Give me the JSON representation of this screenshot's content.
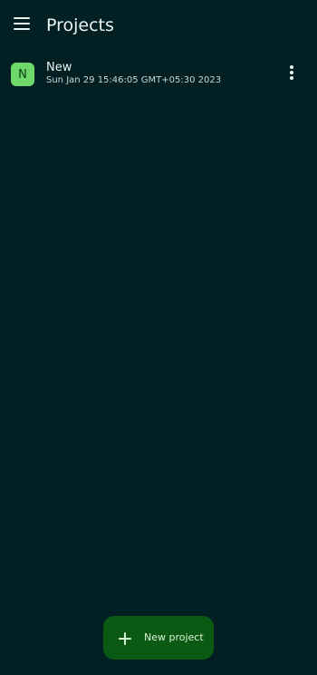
{
  "header": {
    "title": "Projects",
    "menu_icon": "hamburger-menu-icon"
  },
  "projects": [
    {
      "initial": "N",
      "name": "New",
      "date": "Sun Jan 29 15:46:05 GMT+05:30 2023",
      "avatar_color": "#6fd86a",
      "more_icon": "more-vertical-icon"
    }
  ],
  "fab": {
    "label": "New project",
    "icon": "plus-icon"
  },
  "colors": {
    "background": "#021f24",
    "fab_background": "#0b5a14",
    "accent": "#6fd86a"
  }
}
